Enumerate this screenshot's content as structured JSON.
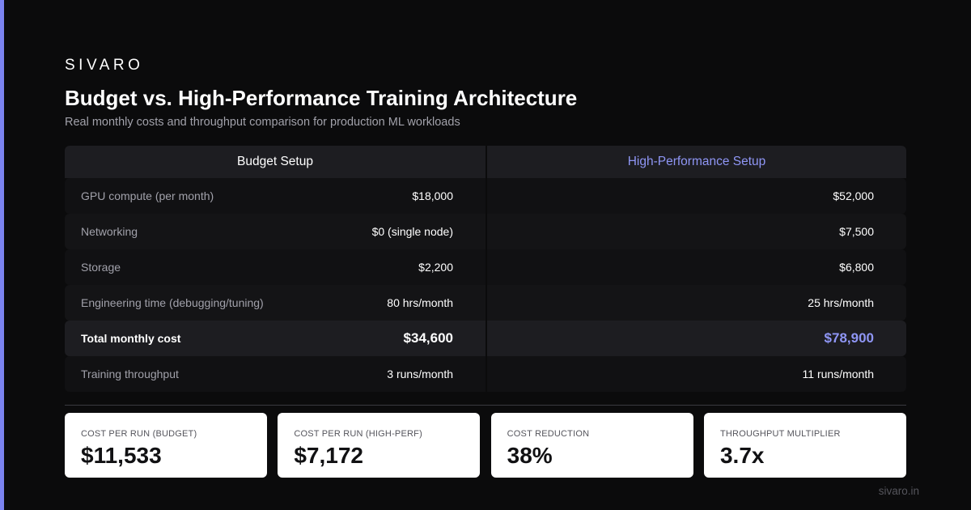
{
  "brand": "SIVARO",
  "title": "Budget vs. High-Performance Training Architecture",
  "subtitle": "Real monthly costs and throughput comparison for production ML workloads",
  "colors": {
    "accent": "#7b83f0",
    "background": "#0b0b0c",
    "card": "#ffffff"
  },
  "table": {
    "headers": {
      "budget": "Budget Setup",
      "performance": "High-Performance Setup"
    },
    "rows": [
      {
        "label": "GPU compute (per month)",
        "budget": "$18,000",
        "performance": "$52,000"
      },
      {
        "label": "Networking",
        "budget": "$0 (single node)",
        "performance": "$7,500"
      },
      {
        "label": "Storage",
        "budget": "$2,200",
        "performance": "$6,800"
      },
      {
        "label": "Engineering time (debugging/tuning)",
        "budget": "80 hrs/month",
        "performance": "25 hrs/month"
      },
      {
        "label": "Total monthly cost",
        "budget": "$34,600",
        "performance": "$78,900"
      },
      {
        "label": "Training throughput",
        "budget": "3 runs/month",
        "performance": "11 runs/month"
      }
    ]
  },
  "cards": [
    {
      "label": "COST PER RUN (BUDGET)",
      "value": "$11,533"
    },
    {
      "label": "COST PER RUN (HIGH-PERF)",
      "value": "$7,172"
    },
    {
      "label": "COST REDUCTION",
      "value": "38%"
    },
    {
      "label": "THROUGHPUT MULTIPLIER",
      "value": "3.7x"
    }
  ],
  "footer": "sivaro.in"
}
